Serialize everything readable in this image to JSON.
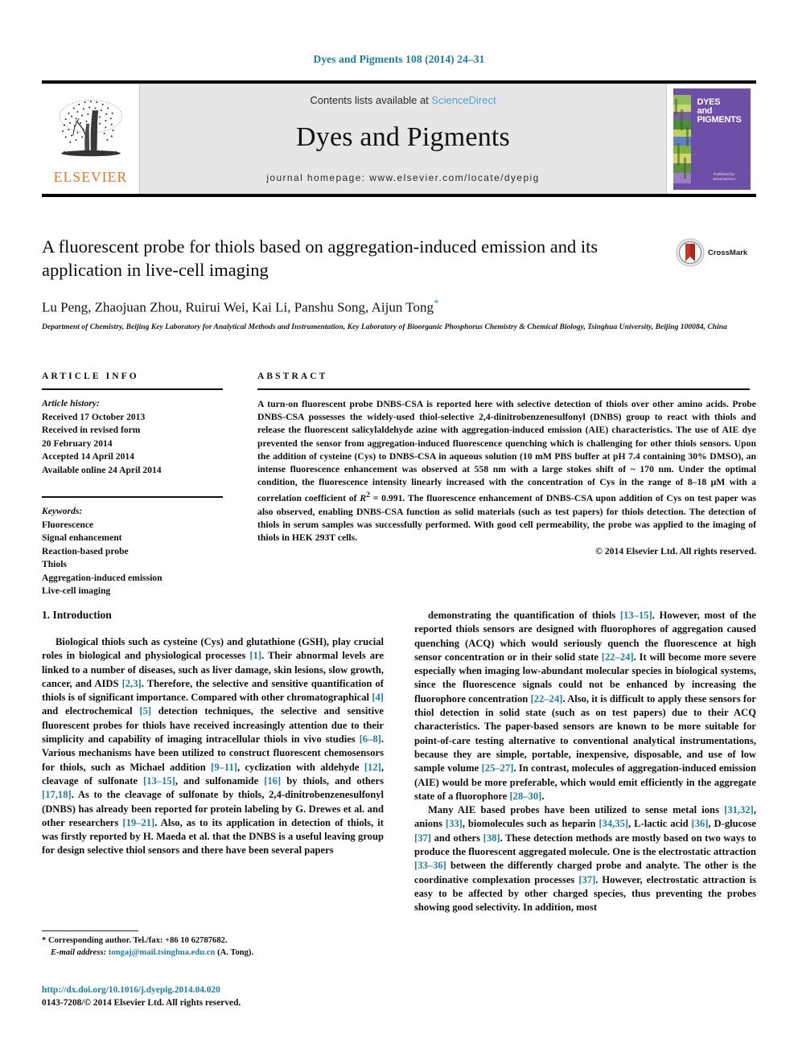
{
  "running_head": "Dyes and Pigments 108 (2014) 24–31",
  "masthead": {
    "publisher_logo_name": "ELSEVIER",
    "contents_prefix": "Contents lists available at ",
    "contents_link": "ScienceDirect",
    "journal_name": "Dyes and Pigments",
    "homepage": "journal homepage: www.elsevier.com/locate/dyepig",
    "cover": {
      "line1": "DYES",
      "line2": "and",
      "line3": "PIGMENTS",
      "publisher_note": "Published by\nScienceDirect\nwww.sciencedirect.com"
    }
  },
  "title": {
    "text": "A fluorescent probe for thiols based on aggregation-induced emission and its application in live-cell imaging",
    "crossmark_label": "CrossMark"
  },
  "authors": {
    "names": "Lu Peng, Zhaojuan Zhou, Ruirui Wei, Kai Li, Panshu Song, Aijun Tong",
    "corresponding_marker": "*",
    "affiliation": "Department of Chemistry, Beijing Key Laboratory for Analytical Methods and Instrumentation, Key Laboratory of Bioorganic Phosphorus Chemistry & Chemical Biology, Tsinghua University, Beijing 100084, China"
  },
  "article_info": {
    "heading": "ARTICLE INFO",
    "history_label": "Article history:",
    "history": [
      "Received 17 October 2013",
      "Received in revised form",
      "20 February 2014",
      "Accepted 14 April 2014",
      "Available online 24 April 2014"
    ],
    "keywords_label": "Keywords:",
    "keywords": [
      "Fluorescence",
      "Signal enhancement",
      "Reaction-based probe",
      "Thiols",
      "Aggregation-induced emission",
      "Live-cell imaging"
    ]
  },
  "abstract": {
    "heading": "ABSTRACT",
    "text": "A turn-on fluorescent probe DNBS-CSA is reported here with selective detection of thiols over other amino acids. Probe DNBS-CSA possesses the widely-used thiol-selective 2,4-dinitrobenzenesulfonyl (DNBS) group to react with thiols and release the fluorescent salicylaldehyde azine with aggregation-induced emission (AIE) characteristics. The use of AIE dye prevented the sensor from aggregation-induced fluorescence quenching which is challenging for other thiols sensors. Upon the addition of cysteine (Cys) to DNBS-CSA in aqueous solution (10 mM PBS buffer at pH 7.4 containing 30% DMSO), an intense fluorescence enhancement was observed at 558 nm with a large stokes shift of ~ 170 nm. Under the optimal condition, the fluorescence intensity linearly increased with the concentration of Cys in the range of 8–18 μM with a correlation coefficient of R² = 0.991. The fluorescence enhancement of DNBS-CSA upon addition of Cys on test paper was also observed, enabling DNBS-CSA function as solid materials (such as test papers) for thiols detection. The detection of thiols in serum samples was successfully performed. With good cell permeability, the probe was applied to the imaging of thiols in HEK 293T cells.",
    "copyright": "© 2014 Elsevier Ltd. All rights reserved."
  },
  "body": {
    "section_title": "1. Introduction",
    "left_paragraphs": [
      "Biological thiols such as cysteine (Cys) and glutathione (GSH), play crucial roles in biological and physiological processes [1]. Their abnormal levels are linked to a number of diseases, such as liver damage, skin lesions, slow growth, cancer, and AIDS [2,3]. Therefore, the selective and sensitive quantification of thiols is of significant importance. Compared with other chromatographical [4] and electrochemical [5] detection techniques, the selective and sensitive fluorescent probes for thiols have received increasingly attention due to their simplicity and capability of imaging intracellular thiols in vivo studies [6–8]. Various mechanisms have been utilized to construct fluorescent chemosensors for thiols, such as Michael addition [9–11], cyclization with aldehyde [12], cleavage of sulfonate [13–15], and sulfonamide [16] by thiols, and others [17,18]. As to the cleavage of sulfonate by thiols, 2,4-dinitrobenzenesulfonyl (DNBS) has already been reported for protein labeling by G. Drewes et al. and other researchers [19–21]. Also, as to its application in detection of thiols, it was firstly reported by H. Maeda et al. that the DNBS is a useful leaving group for design selective thiol sensors and there have been several papers"
    ],
    "right_paragraphs": [
      "demonstrating the quantification of thiols [13–15]. However, most of the reported thiols sensors are designed with fluorophores of aggregation caused quenching (ACQ) which would seriously quench the fluorescence at high sensor concentration or in their solid state [22–24]. It will become more severe especially when imaging low-abundant molecular species in biological systems, since the fluorescence signals could not be enhanced by increasing the fluorophore concentration [22–24]. Also, it is difficult to apply these sensors for thiol detection in solid state (such as on test papers) due to their ACQ characteristics. The paper-based sensors are known to be more suitable for point-of-care testing alternative to conventional analytical instrumentations, because they are simple, portable, inexpensive, disposable, and use of low sample volume [25–27]. In contrast, molecules of aggregation-induced emission (AIE) would be more preferable, which would emit efficiently in the aggregate state of a fluorophore [28–30].",
      "Many AIE based probes have been utilized to sense metal ions [31,32], anions [33], biomolecules such as heparin [34,35], L-lactic acid [36], D-glucose [37] and others [38]. These detection methods are mostly based on two ways to produce the fluorescent aggregated molecule. One is the electrostatic attraction [33–36] between the differently charged probe and analyte. The other is the coordinative complexation processes [37]. However, electrostatic attraction is easy to be affected by other charged species, thus preventing the probes showing good selectivity. In addition, most"
    ]
  },
  "footnote": {
    "corresponding": "* Corresponding author. Tel./fax: +86 10 62787682.",
    "email_label": "E-mail address:",
    "email": "tongaj@mail.tsinghua.edu.cn",
    "email_suffix": "(A. Tong)."
  },
  "footer": {
    "doi": "http://dx.doi.org/10.1016/j.dyepig.2014.04.020",
    "issn": "0143-7208/© 2014 Elsevier Ltd. All rights reserved."
  },
  "colors": {
    "link_blue": "#1a7fa8",
    "science_direct_blue": "#4ea3d4",
    "elsevier_orange": "#E87722",
    "cover_purple": "#6d4fa8"
  }
}
